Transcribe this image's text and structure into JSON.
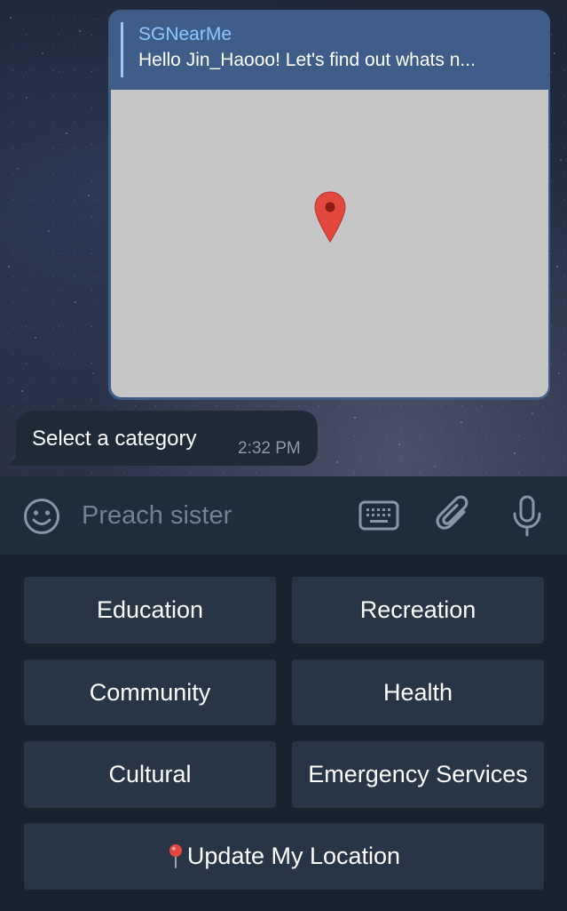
{
  "chat": {
    "bot_message": {
      "reply_sender": "SGNearMe",
      "reply_text": "Hello Jin_Haooo! Let's find out whats n..."
    },
    "location_pin_icon": "map-pin-icon",
    "category_message": {
      "text": "Select a category",
      "time": "2:32 PM"
    }
  },
  "composer": {
    "placeholder": "Preach sister",
    "icons": [
      "emoji-icon",
      "keyboard-icon",
      "paperclip-icon",
      "microphone-icon"
    ]
  },
  "keyboard": {
    "buttons": [
      {
        "label": "Education"
      },
      {
        "label": "Recreation"
      },
      {
        "label": "Community"
      },
      {
        "label": "Health"
      },
      {
        "label": "Cultural"
      },
      {
        "label": "Emergency Services"
      },
      {
        "label": "Update My Location",
        "icon": "round-pushpin-icon"
      }
    ]
  },
  "colors": {
    "bubble_outgoing": "#3f5d89",
    "bubble_incoming": "#1e2a38",
    "reply_accent": "#8fc7ff",
    "panel_background": "#182330",
    "button_background": "#273546",
    "pin_red": "#e2483d"
  }
}
